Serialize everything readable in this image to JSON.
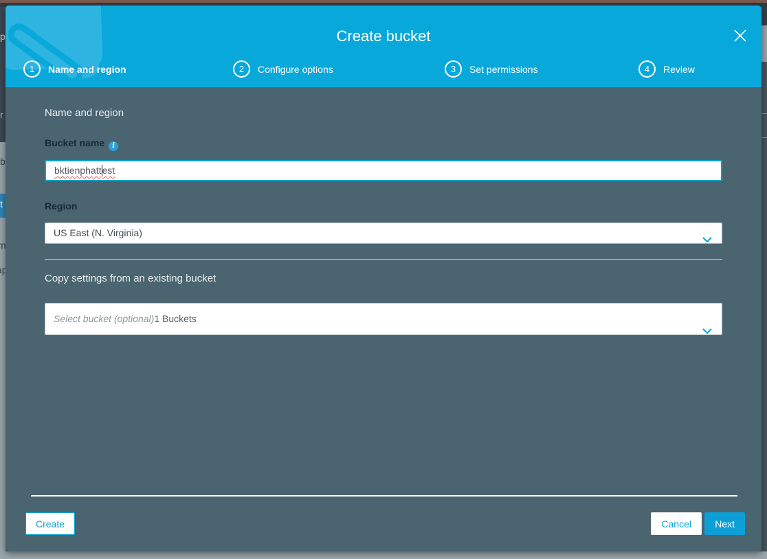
{
  "colors": {
    "header_cyan": "#09a8da",
    "watermark_cyan": "#2db4e1",
    "body_slate": "#4a6470",
    "accent_cyan": "#0d9fd6",
    "focus_border": "#00a1c9",
    "selected_row_blue": "#2e84b5"
  },
  "background": {
    "left_fragments": {
      "f1": "p",
      "f2": "r",
      "f3": "b",
      "f4": "t",
      "f5": "m",
      "f6": "ap"
    }
  },
  "modal": {
    "title": "Create bucket",
    "steps": [
      {
        "number": "1",
        "label": "Name and region"
      },
      {
        "number": "2",
        "label": "Configure options"
      },
      {
        "number": "3",
        "label": "Set permissions"
      },
      {
        "number": "4",
        "label": "Review"
      }
    ],
    "body": {
      "section_heading": "Name and region",
      "bucket_name_label": "Bucket name",
      "info_icon_glyph": "i",
      "bucket_name_value": "bktienphattest",
      "bucket_name_before_caret": "bktienphatt",
      "bucket_name_after_caret": "est",
      "region_label": "Region",
      "region_value": "US East (N. Virginia)",
      "copy_heading": "Copy settings from an existing bucket",
      "copy_placeholder": "Select bucket (optional)",
      "copy_suffix": "1 Buckets"
    },
    "footer": {
      "create_label": "Create",
      "cancel_label": "Cancel",
      "next_label": "Next"
    }
  }
}
